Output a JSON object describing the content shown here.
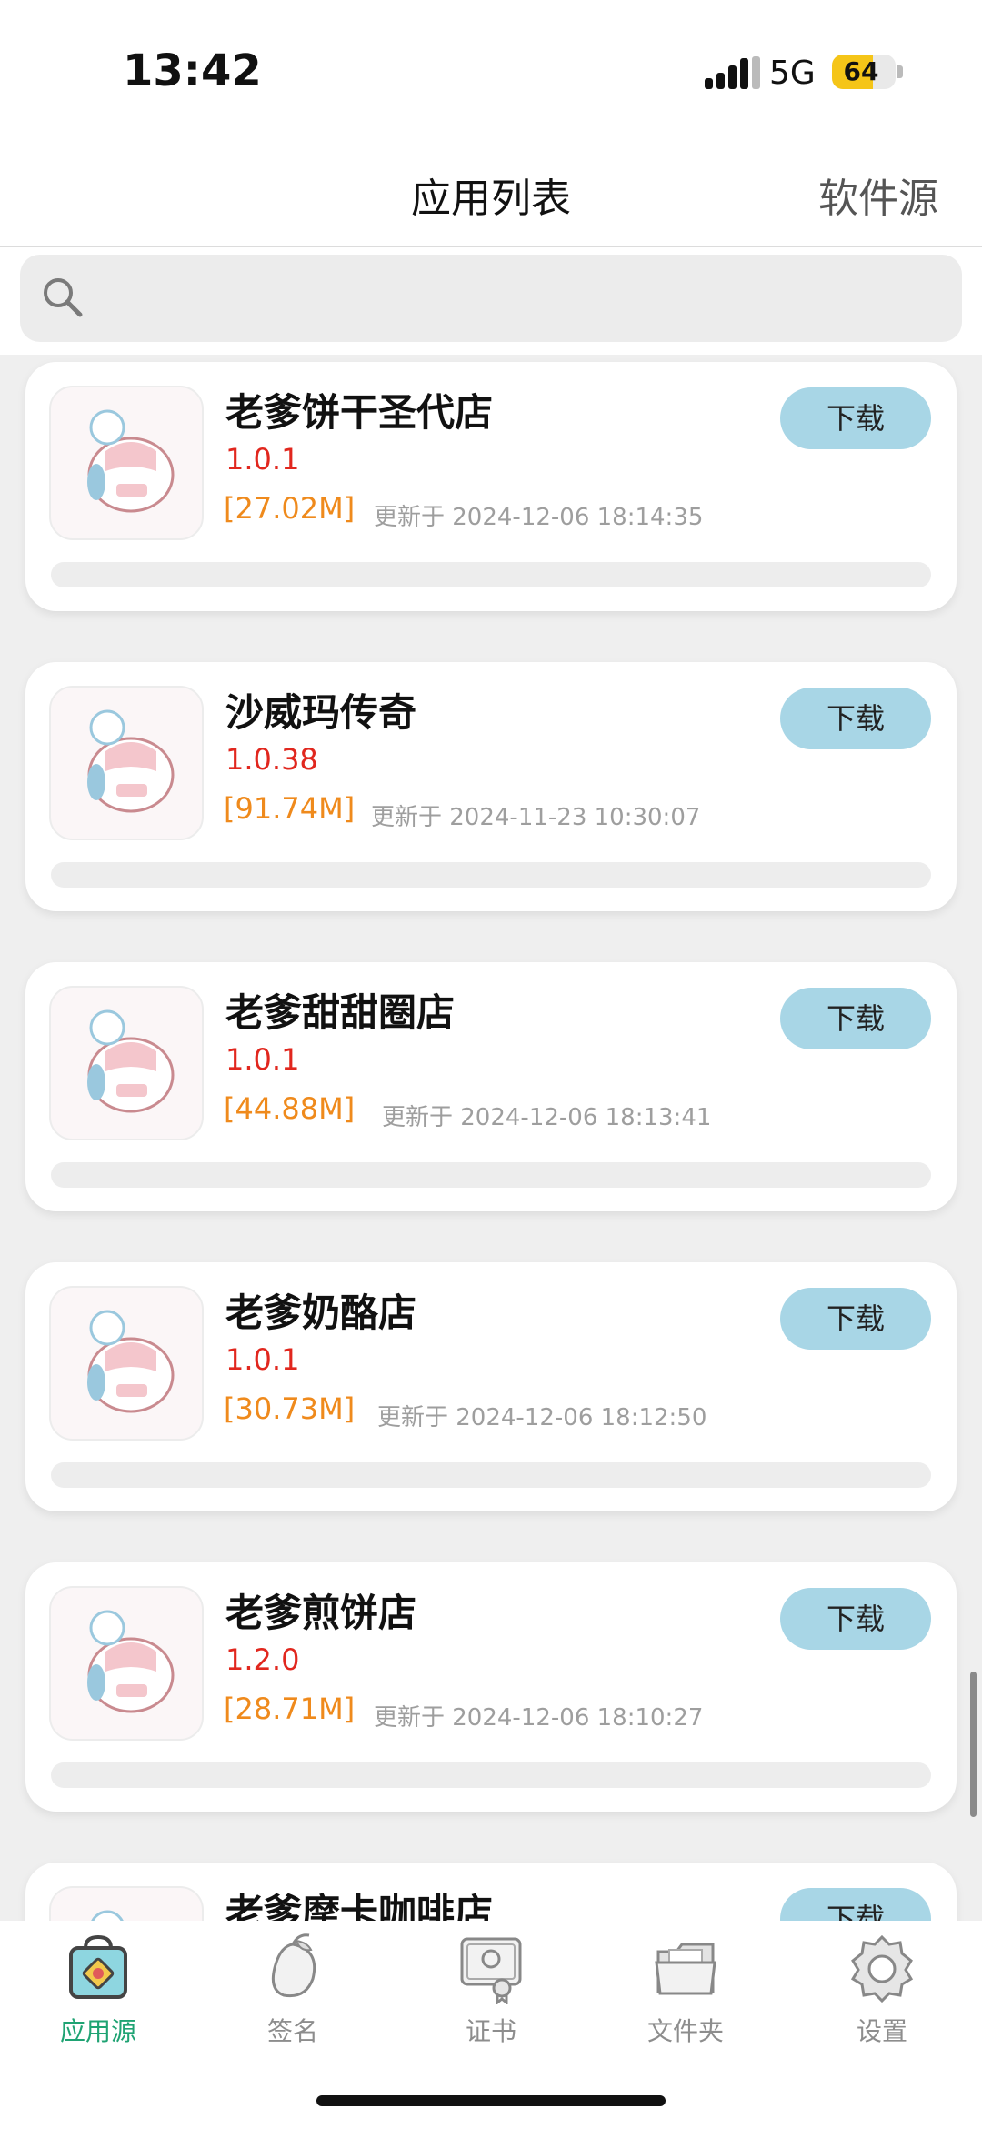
{
  "status_bar": {
    "time": "13:42",
    "network": "5G",
    "battery": "64",
    "battery_level_pct": 64
  },
  "header": {
    "title": "应用列表",
    "right_link": "软件源"
  },
  "search": {
    "placeholder": "",
    "value": ""
  },
  "list_action_label": "下载",
  "apps": [
    {
      "name": "老爹饼干圣代店",
      "version": "1.0.1",
      "size": "[27.02M]",
      "updated": "更新于 2024-12-06 18:14:35",
      "progress": 0
    },
    {
      "name": "沙威玛传奇",
      "version": "1.0.38",
      "size": "[91.74M]",
      "updated": "更新于 2024-11-23 10:30:07",
      "progress": 0
    },
    {
      "name": "老爹甜甜圈店",
      "version": "1.0.1",
      "size": "[44.88M]",
      "updated": "更新于 2024-12-06 18:13:41",
      "progress": 0
    },
    {
      "name": "老爹奶酪店",
      "version": "1.0.1",
      "size": "[30.73M]",
      "updated": "更新于 2024-12-06 18:12:50",
      "progress": 0
    },
    {
      "name": "老爹煎饼店",
      "version": "1.2.0",
      "size": "[28.71M]",
      "updated": "更新于 2024-12-06 18:10:27",
      "progress": 0
    },
    {
      "name": "老爹摩卡咖啡店",
      "version": "",
      "size": "",
      "updated": "",
      "progress": 0
    }
  ],
  "tabs": [
    {
      "label": "应用源",
      "icon": "store-bag-icon",
      "active": true
    },
    {
      "label": "签名",
      "icon": "mango-icon",
      "active": false
    },
    {
      "label": "证书",
      "icon": "certificate-icon",
      "active": false
    },
    {
      "label": "文件夹",
      "icon": "folder-icon",
      "active": false
    },
    {
      "label": "设置",
      "icon": "gear-icon",
      "active": false
    }
  ],
  "colors": {
    "accent": "#1fa373",
    "download_button": "#a8d6e6",
    "version": "#e1271e",
    "size": "#ef8a1c"
  }
}
